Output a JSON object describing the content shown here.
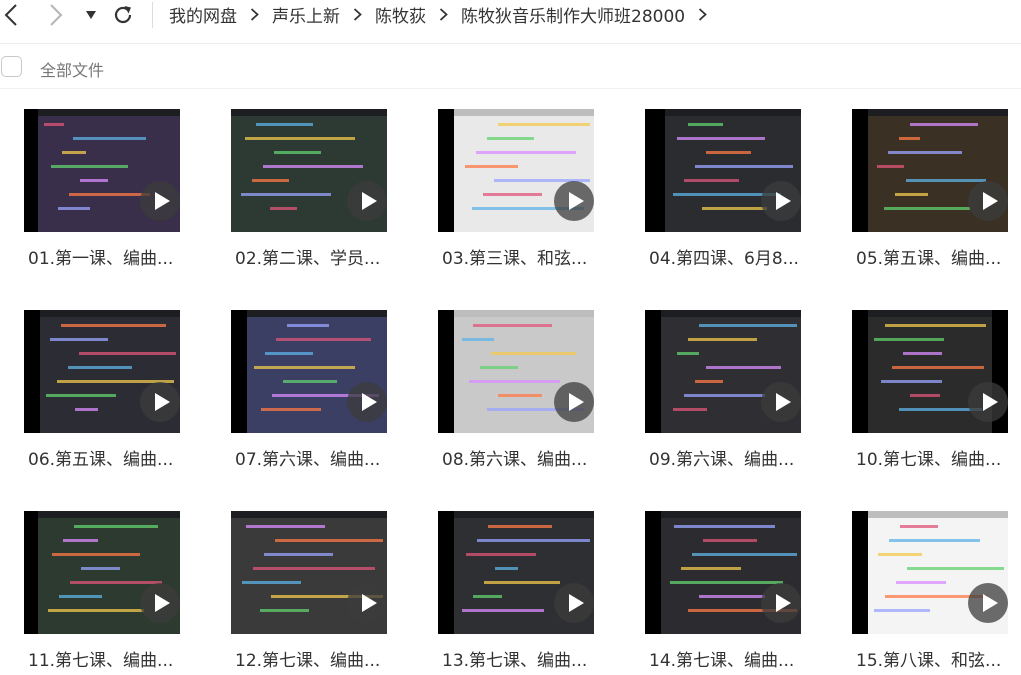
{
  "nav": {
    "back_icon": "chevron-left-icon",
    "forward_icon": "chevron-right-icon",
    "menu_icon": "caret-down-icon",
    "refresh_icon": "refresh-icon"
  },
  "breadcrumb": [
    "我的网盘",
    "声乐上新",
    "陈牧荻",
    "陈牧狄音乐制作大师班28000"
  ],
  "select_all_label": "全部文件",
  "files": [
    {
      "label": "01.第一课、编曲...",
      "icon": "video-thumbnail"
    },
    {
      "label": "02.第二课、学员...",
      "icon": "video-thumbnail"
    },
    {
      "label": "03.第三课、和弦...",
      "icon": "video-thumbnail"
    },
    {
      "label": "04.第四课、6月8...",
      "icon": "video-thumbnail"
    },
    {
      "label": "05.第五课、编曲...",
      "icon": "video-thumbnail"
    },
    {
      "label": "06.第五课、编曲...",
      "icon": "video-thumbnail"
    },
    {
      "label": "07.第六课、编曲...",
      "icon": "video-thumbnail"
    },
    {
      "label": "08.第六课、编曲...",
      "icon": "video-thumbnail"
    },
    {
      "label": "09.第六课、编曲...",
      "icon": "video-thumbnail"
    },
    {
      "label": "10.第七课、编曲...",
      "icon": "video-thumbnail"
    },
    {
      "label": "11.第七课、编曲...",
      "icon": "video-thumbnail"
    },
    {
      "label": "12.第七课、编曲...",
      "icon": "video-thumbnail"
    },
    {
      "label": "13.第七课、编曲...",
      "icon": "video-thumbnail"
    },
    {
      "label": "14.第七课、编曲...",
      "icon": "video-thumbnail"
    },
    {
      "label": "15.第八课、和弦...",
      "icon": "video-thumbnail"
    }
  ]
}
